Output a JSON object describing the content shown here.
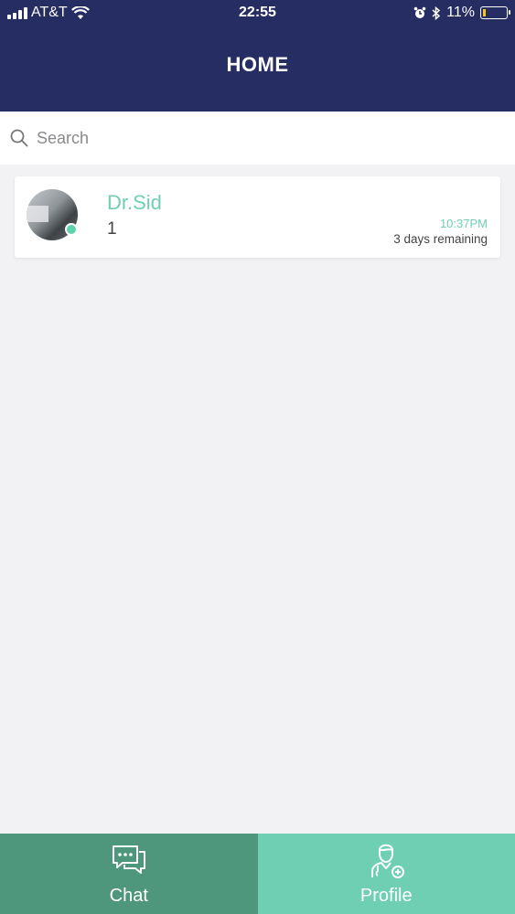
{
  "status_bar": {
    "carrier": "AT&T",
    "time": "22:55",
    "battery": "11%",
    "icons": [
      "signal-icon",
      "wifi-icon",
      "alarm-icon",
      "bluetooth-icon",
      "battery-icon"
    ]
  },
  "header": {
    "title": "HOME"
  },
  "search": {
    "placeholder": "Search",
    "value": "",
    "icon": "search-icon"
  },
  "chats": [
    {
      "name": "Dr.Sid",
      "last_message": "1",
      "time": "10:37PM",
      "remaining": "3 days remaining",
      "online": true
    }
  ],
  "tabs": [
    {
      "label": "Chat",
      "icon": "chat-bubbles-icon",
      "active": true,
      "color": "#4f977c"
    },
    {
      "label": "Profile",
      "icon": "doctor-profile-icon",
      "active": false,
      "color": "#6fcfb3"
    }
  ],
  "colors": {
    "header": "#252d63",
    "accent": "#6fcfb3",
    "background": "#f2f2f5"
  }
}
